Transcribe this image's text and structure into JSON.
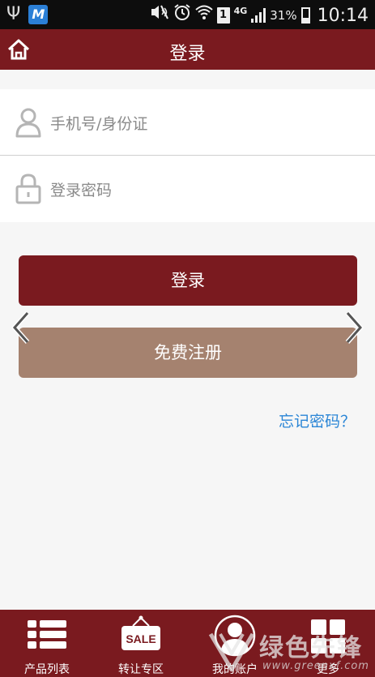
{
  "status_bar": {
    "icons": [
      "usb-icon",
      "app-m-icon",
      "mute-icon",
      "alarm-icon",
      "wifi-icon",
      "sim-icon",
      "signal-icon",
      "battery-icon"
    ],
    "sim_slot": "1",
    "network": "4G",
    "battery": "31%",
    "battery_level": 0.31,
    "time": "10:14",
    "app_badge": "M"
  },
  "header": {
    "title": "登录",
    "home_icon": "home-icon"
  },
  "login_form": {
    "account_placeholder": "手机号/身份证",
    "password_placeholder": "登录密码"
  },
  "actions": {
    "login_label": "登录",
    "register_label": "免费注册",
    "forgot_label": "忘记密码？"
  },
  "tabs": [
    {
      "label": "产品列表",
      "icon": "list-icon"
    },
    {
      "label": "转让专区",
      "icon": "sale-tag-icon",
      "badge_text": "SALE"
    },
    {
      "label": "我的账户",
      "icon": "user-icon"
    },
    {
      "label": "更多",
      "icon": "grid-icon"
    }
  ],
  "watermark": {
    "text": "绿色先锋",
    "url": "www.greenxf.com"
  },
  "colors": {
    "primary": "#7a1a1f",
    "register_button": "#a5826f",
    "link": "#2b86d6",
    "background": "#f6f6f6"
  }
}
